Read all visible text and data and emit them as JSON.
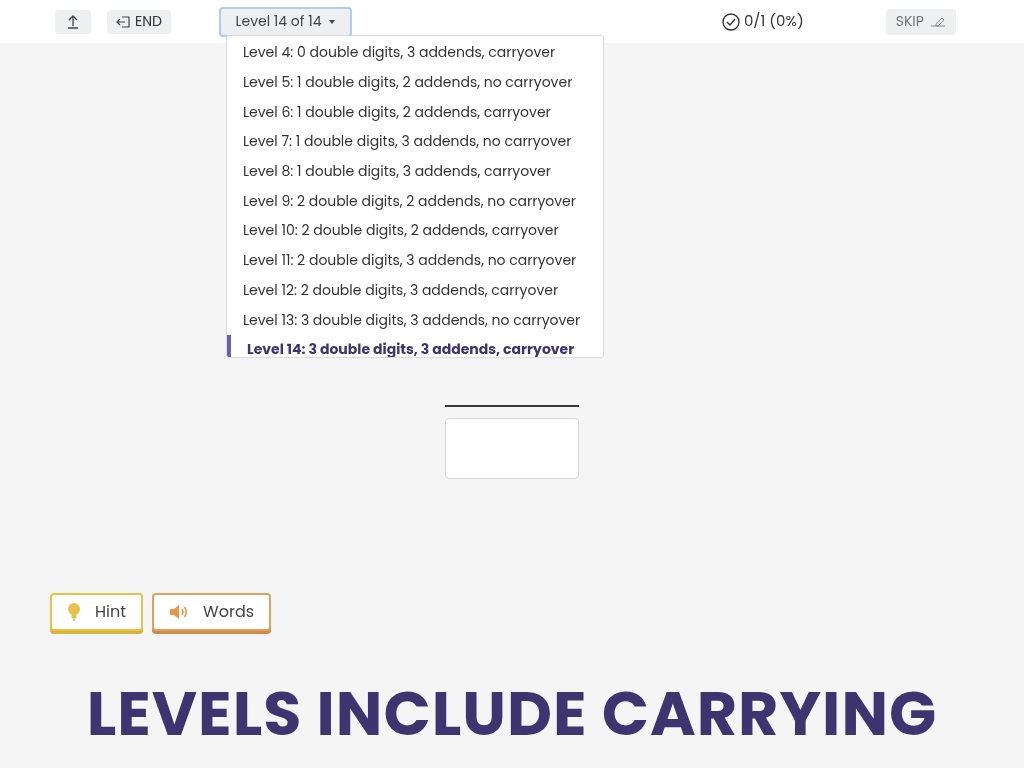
{
  "toolbar": {
    "end_label": "END",
    "level_select": "Level 14 of 14",
    "progress": "0/1 (0%)",
    "skip_label": "SKIP"
  },
  "level_menu": [
    {
      "label": "Level 4: 0 double digits, 3 addends, carryover",
      "selected": false
    },
    {
      "label": "Level 5: 1 double digits, 2 addends, no carryover",
      "selected": false
    },
    {
      "label": "Level 6: 1 double digits, 2 addends, carryover",
      "selected": false
    },
    {
      "label": "Level 7: 1 double digits, 3 addends, no carryover",
      "selected": false
    },
    {
      "label": "Level 8: 1 double digits, 3 addends, carryover",
      "selected": false
    },
    {
      "label": "Level 9: 2 double digits, 2 addends, no carryover",
      "selected": false
    },
    {
      "label": "Level 10: 2 double digits, 2 addends, carryover",
      "selected": false
    },
    {
      "label": "Level 11: 2 double digits, 3 addends, no carryover",
      "selected": false
    },
    {
      "label": "Level 12: 2 double digits, 3 addends, carryover",
      "selected": false
    },
    {
      "label": "Level 13: 3 double digits, 3 addends, no carryover",
      "selected": false
    },
    {
      "label": "Level 14: 3 double digits, 3 addends, carryover",
      "selected": true
    }
  ],
  "helpers": [
    {
      "kind": "hint",
      "label": "Hint"
    },
    {
      "kind": "words",
      "label": "Words"
    }
  ],
  "banner": "LEVELS INCLUDE CARRYING"
}
